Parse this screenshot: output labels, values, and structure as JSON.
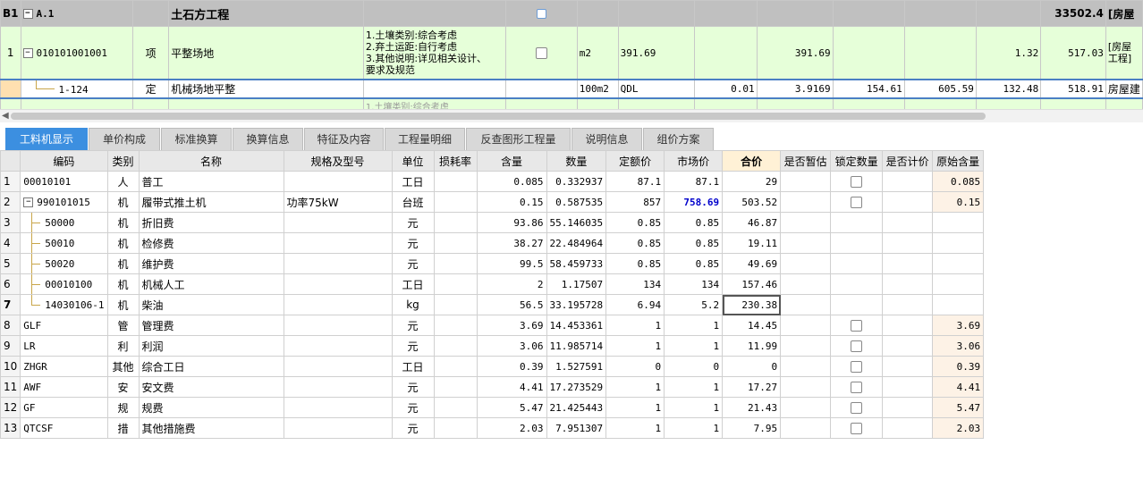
{
  "top_grid": {
    "header_row": {
      "row_id": "B1",
      "code": "A.1",
      "name": "土石方工程",
      "total": "33502.4",
      "tail": "[房屋"
    },
    "row1": {
      "no": "1",
      "code": "010101001001",
      "type": "项",
      "name": "平整场地",
      "desc_lines": [
        "1.土壤类别:综合考虑",
        "2.弃土运距:自行考虑",
        "3.其他说明:详见相关设计、",
        "要求及规范"
      ],
      "unit": "m2",
      "qty_expr": "391.69",
      "qty": "391.69",
      "unit_price": "1.32",
      "total": "517.03",
      "tail": "[房屋\n工程]"
    },
    "row2": {
      "code": "1-124",
      "type": "定",
      "name": "机械场地平整",
      "unit": "100m2",
      "qty_expr": "QDL",
      "content": "0.01",
      "qty": "3.9169",
      "c1": "154.61",
      "c2": "605.59",
      "unit_price": "132.48",
      "total": "518.91",
      "tail": "房屋建"
    },
    "row3_partial": "1.土壤类别:综合考虑"
  },
  "tabs": [
    {
      "label": "工料机显示",
      "active": true
    },
    {
      "label": "单价构成",
      "active": false
    },
    {
      "label": "标准换算",
      "active": false
    },
    {
      "label": "换算信息",
      "active": false
    },
    {
      "label": "特征及内容",
      "active": false
    },
    {
      "label": "工程量明细",
      "active": false
    },
    {
      "label": "反查图形工程量",
      "active": false
    },
    {
      "label": "说明信息",
      "active": false
    },
    {
      "label": "组价方案",
      "active": false
    }
  ],
  "bottom_grid": {
    "columns": [
      "编码",
      "类别",
      "名称",
      "规格及型号",
      "单位",
      "损耗率",
      "含量",
      "数量",
      "定额价",
      "市场价",
      "合价",
      "是否暂估",
      "锁定数量",
      "是否计价",
      "原始含量"
    ],
    "rows": [
      {
        "no": "1",
        "code": "00010101",
        "cat": "人",
        "name": "普工",
        "spec": "",
        "unit": "工日",
        "loss": "",
        "content": "0.085",
        "qty": "0.332937",
        "price": "87.1",
        "market": "87.1",
        "total": "29",
        "check": true,
        "orig": "0.085"
      },
      {
        "no": "2",
        "code": "990101015",
        "cat": "机",
        "name": "履带式推土机",
        "spec": "功率75kW",
        "unit": "台班",
        "loss": "",
        "content": "0.15",
        "qty": "0.587535",
        "price": "857",
        "market": "758.69",
        "total": "503.52",
        "check": true,
        "orig": "0.15"
      },
      {
        "no": "3",
        "code": "50000",
        "cat": "机",
        "name": "折旧费",
        "spec": "",
        "unit": "元",
        "loss": "",
        "content": "93.86",
        "qty": "55.146035",
        "price": "0.85",
        "market": "0.85",
        "total": "46.87",
        "check": false,
        "orig": ""
      },
      {
        "no": "4",
        "code": "50010",
        "cat": "机",
        "name": "检修费",
        "spec": "",
        "unit": "元",
        "loss": "",
        "content": "38.27",
        "qty": "22.484964",
        "price": "0.85",
        "market": "0.85",
        "total": "19.11",
        "check": false,
        "orig": ""
      },
      {
        "no": "5",
        "code": "50020",
        "cat": "机",
        "name": "维护费",
        "spec": "",
        "unit": "元",
        "loss": "",
        "content": "99.5",
        "qty": "58.459733",
        "price": "0.85",
        "market": "0.85",
        "total": "49.69",
        "check": false,
        "orig": ""
      },
      {
        "no": "6",
        "code": "00010100",
        "cat": "机",
        "name": "机械人工",
        "spec": "",
        "unit": "工日",
        "loss": "",
        "content": "2",
        "qty": "1.17507",
        "price": "134",
        "market": "134",
        "total": "157.46",
        "check": false,
        "orig": ""
      },
      {
        "no": "7",
        "code": "14030106-1",
        "cat": "机",
        "name": "柴油",
        "spec": "",
        "unit": "kg",
        "loss": "",
        "content": "56.5",
        "qty": "33.195728",
        "price": "6.94",
        "market": "5.2",
        "total": "230.38",
        "check": false,
        "orig": ""
      },
      {
        "no": "8",
        "code": "GLF",
        "cat": "管",
        "name": "管理费",
        "spec": "",
        "unit": "元",
        "loss": "",
        "content": "3.69",
        "qty": "14.453361",
        "price": "1",
        "market": "1",
        "total": "14.45",
        "check": true,
        "orig": "3.69"
      },
      {
        "no": "9",
        "code": "LR",
        "cat": "利",
        "name": "利润",
        "spec": "",
        "unit": "元",
        "loss": "",
        "content": "3.06",
        "qty": "11.985714",
        "price": "1",
        "market": "1",
        "total": "11.99",
        "check": true,
        "orig": "3.06"
      },
      {
        "no": "10",
        "code": "ZHGR",
        "cat": "其他",
        "name": "综合工日",
        "spec": "",
        "unit": "工日",
        "loss": "",
        "content": "0.39",
        "qty": "1.527591",
        "price": "0",
        "market": "0",
        "total": "0",
        "check": true,
        "orig": "0.39"
      },
      {
        "no": "11",
        "code": "AWF",
        "cat": "安",
        "name": "安文费",
        "spec": "",
        "unit": "元",
        "loss": "",
        "content": "4.41",
        "qty": "17.273529",
        "price": "1",
        "market": "1",
        "total": "17.27",
        "check": true,
        "orig": "4.41"
      },
      {
        "no": "12",
        "code": "GF",
        "cat": "规",
        "name": "规费",
        "spec": "",
        "unit": "元",
        "loss": "",
        "content": "5.47",
        "qty": "21.425443",
        "price": "1",
        "market": "1",
        "total": "21.43",
        "check": true,
        "orig": "5.47"
      },
      {
        "no": "13",
        "code": "QTCSF",
        "cat": "措",
        "name": "其他措施费",
        "spec": "",
        "unit": "元",
        "loss": "",
        "content": "2.03",
        "qty": "7.951307",
        "price": "1",
        "market": "1",
        "total": "7.95",
        "check": true,
        "orig": "2.03"
      }
    ]
  }
}
